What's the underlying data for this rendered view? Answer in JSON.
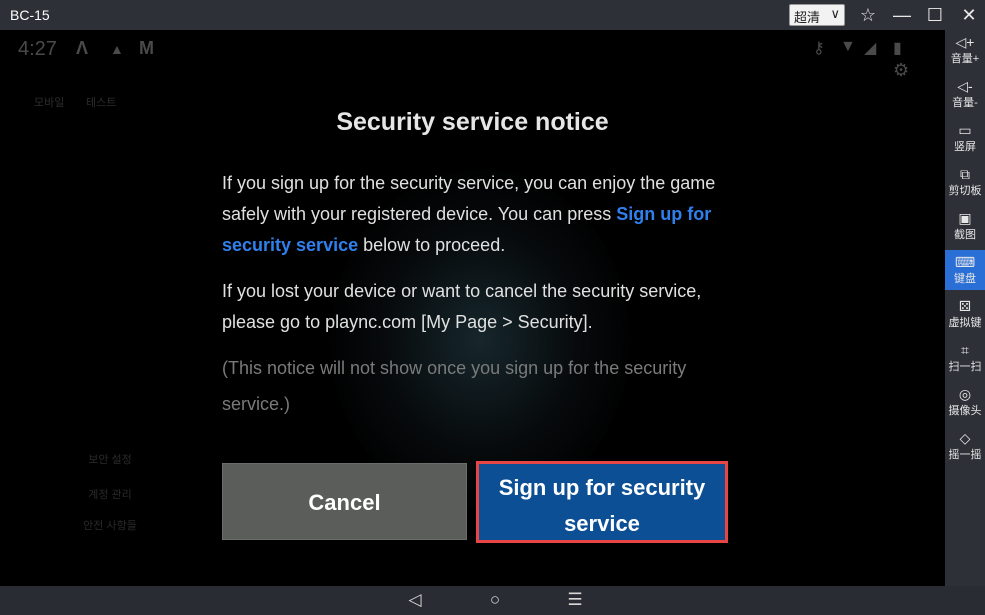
{
  "window": {
    "title": "BC-15",
    "quality_label": "超清",
    "quality_arrow": "∨",
    "pin_icon": "☆",
    "minimize_icon": "—",
    "maximize_icon": "☐",
    "close_icon": "✕"
  },
  "rail": {
    "items": [
      {
        "icon": "◁+",
        "label": "音量+"
      },
      {
        "icon": "◁-",
        "label": "音量-"
      },
      {
        "icon": "▭",
        "label": "竖屏"
      },
      {
        "icon": "⧉",
        "label": "剪切板"
      },
      {
        "icon": "▣",
        "label": "截图"
      },
      {
        "icon": "⌨",
        "label": "键盘"
      },
      {
        "icon": "⚄",
        "label": "虚拟键"
      },
      {
        "icon": "⌗",
        "label": "扫一扫"
      },
      {
        "icon": "◎",
        "label": "摄像头"
      },
      {
        "icon": "◇",
        "label": "摇一摇"
      }
    ],
    "active_index": 5,
    "active_color": "#2a6fd6"
  },
  "status_bar": {
    "time": "4:27",
    "icons": [
      "Λ",
      "▲",
      "M"
    ],
    "right_icons": [
      "⚷",
      "▼",
      "◢",
      "▮"
    ],
    "settings_icon": "⚙"
  },
  "background": {
    "app_labels": [
      "모바일",
      "테스트"
    ],
    "menu_items": [
      "보안 설정",
      "계정 관리",
      "안전 사항들"
    ]
  },
  "dialog": {
    "title": "Security service notice",
    "para1_before": "If you sign up for the security service, you can enjoy the game safely with your registered device. You can press ",
    "para1_link": "Sign up for security service",
    "para1_after": " below to proceed.",
    "para2": "If you lost your device or want to cancel the security service, please go to plaync.com [My Page > Security].",
    "para3": "(This notice will not show once you sign up for the security service.)",
    "cancel_label": "Cancel",
    "signup_label": "Sign up for security service",
    "link_color": "#2f80ed",
    "signup_color": "#0c4f94",
    "highlight_border": "#e84545"
  },
  "navbar": {
    "back_icon": "◁",
    "home_icon": "○",
    "menu_icon": "☰"
  }
}
